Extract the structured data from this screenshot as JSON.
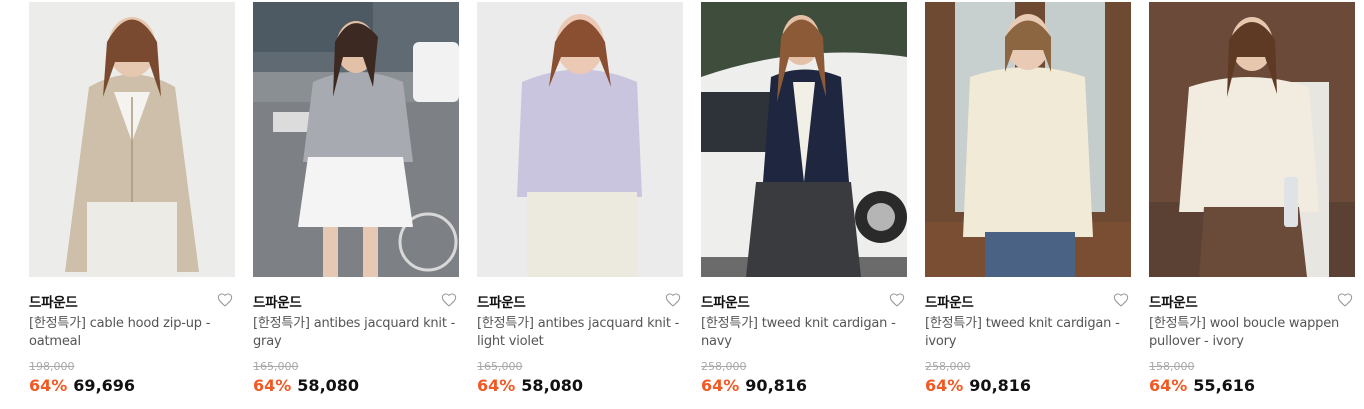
{
  "products": [
    {
      "brand": "드파운드",
      "title": "[한정특가] cable hood zip-up - oatmeal",
      "original_price": "198,000",
      "discount": "64%",
      "price": "69,696",
      "image": "woman-beige-cable-hood-zipup"
    },
    {
      "brand": "드파운드",
      "title": "[한정특가] antibes jacquard knit - gray",
      "original_price": "165,000",
      "discount": "64%",
      "price": "58,080",
      "image": "woman-gray-antibes-knit-street"
    },
    {
      "brand": "드파운드",
      "title": "[한정특가] antibes jacquard knit - light violet",
      "original_price": "165,000",
      "discount": "64%",
      "price": "58,080",
      "image": "woman-violet-antibes-knit"
    },
    {
      "brand": "드파운드",
      "title": "[한정특가] tweed knit cardigan - navy",
      "original_price": "258,000",
      "discount": "64%",
      "price": "90,816",
      "image": "woman-navy-cardigan-car"
    },
    {
      "brand": "드파운드",
      "title": "[한정특가] tweed knit cardigan - ivory",
      "original_price": "258,000",
      "discount": "64%",
      "price": "90,816",
      "image": "woman-ivory-cardigan-window"
    },
    {
      "brand": "드파운드",
      "title": "[한정특가] wool boucle wappen pullover - ivory",
      "original_price": "158,000",
      "discount": "64%",
      "price": "55,616",
      "image": "woman-ivory-pullover-indoor"
    }
  ],
  "colors": {
    "discount": "#f15a24",
    "original_price": "#aaaaaa",
    "title": "#555555"
  },
  "icons": {
    "wishlist": "heart-outline-icon"
  }
}
